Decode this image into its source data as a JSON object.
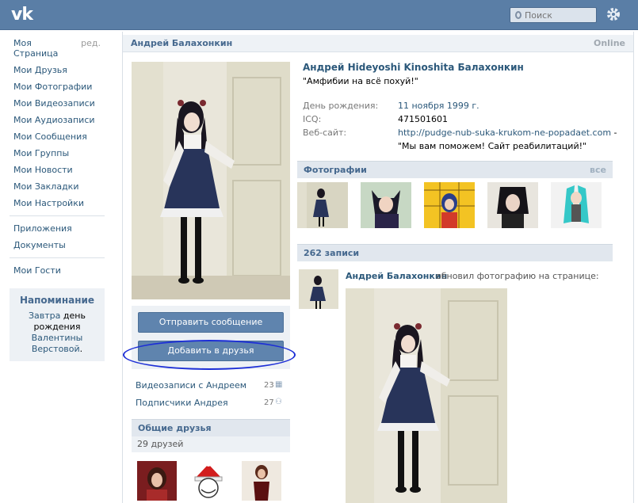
{
  "header": {
    "logo": "vk",
    "search_placeholder": "Поиск"
  },
  "sidebar": {
    "items": [
      {
        "label": "Моя Страница",
        "edit": "ред."
      },
      {
        "label": "Мои Друзья"
      },
      {
        "label": "Мои Фотографии"
      },
      {
        "label": "Мои Видеозаписи"
      },
      {
        "label": "Мои Аудиозаписи"
      },
      {
        "label": "Мои Сообщения"
      },
      {
        "label": "Мои Группы"
      },
      {
        "label": "Мои Новости"
      },
      {
        "label": "Мои Закладки"
      },
      {
        "label": "Мои Настройки"
      }
    ],
    "apps": [
      "Приложения",
      "Документы"
    ],
    "guests": "Мои Гости",
    "reminder": {
      "title": "Напоминание",
      "tomorrow": "Завтра",
      "text1": "день рождения",
      "person": "Валентины Верстовой",
      "dot": "."
    }
  },
  "profile": {
    "header_name": "Андрей Балахонкин",
    "online": "Online",
    "full_name": "Андрей Hideyoshi Kinoshita Балахонкин",
    "status": "\"Амфибии на всё похуй!\"",
    "info": {
      "birthday_label": "День рождения:",
      "birthday_value": "11 ноября 1999 г.",
      "icq_label": "ICQ:",
      "icq_value": "471501601",
      "site_label": "Веб-сайт:",
      "site_value": "http://pudge-nub-suka-krukom-ne-popadaet.com",
      "site_dash": "-",
      "site_quote": "\"Мы вам поможем! Сайт реабилитаций!\""
    },
    "send_message": "Отправить сообщение",
    "add_friend": "Добавить в друзья",
    "videos_link": "Видеозаписи с Андреем",
    "videos_count": "23",
    "subscribers_link": "Подписчики Андрея",
    "subscribers_count": "27",
    "mutual_friends": "Общие друзья",
    "friends_count": "29 друзей",
    "photos_title": "Фотографии",
    "photos_all": "все",
    "wall_count": "262 записи",
    "post_author": "Андрей Балахонкин",
    "post_action": "обновил фотографию на странице:"
  },
  "colors": {
    "header_bg": "#5a7ea6",
    "link": "#2b587a",
    "button": "#5f84ae",
    "annotation_oval": "#1d2fd6"
  }
}
